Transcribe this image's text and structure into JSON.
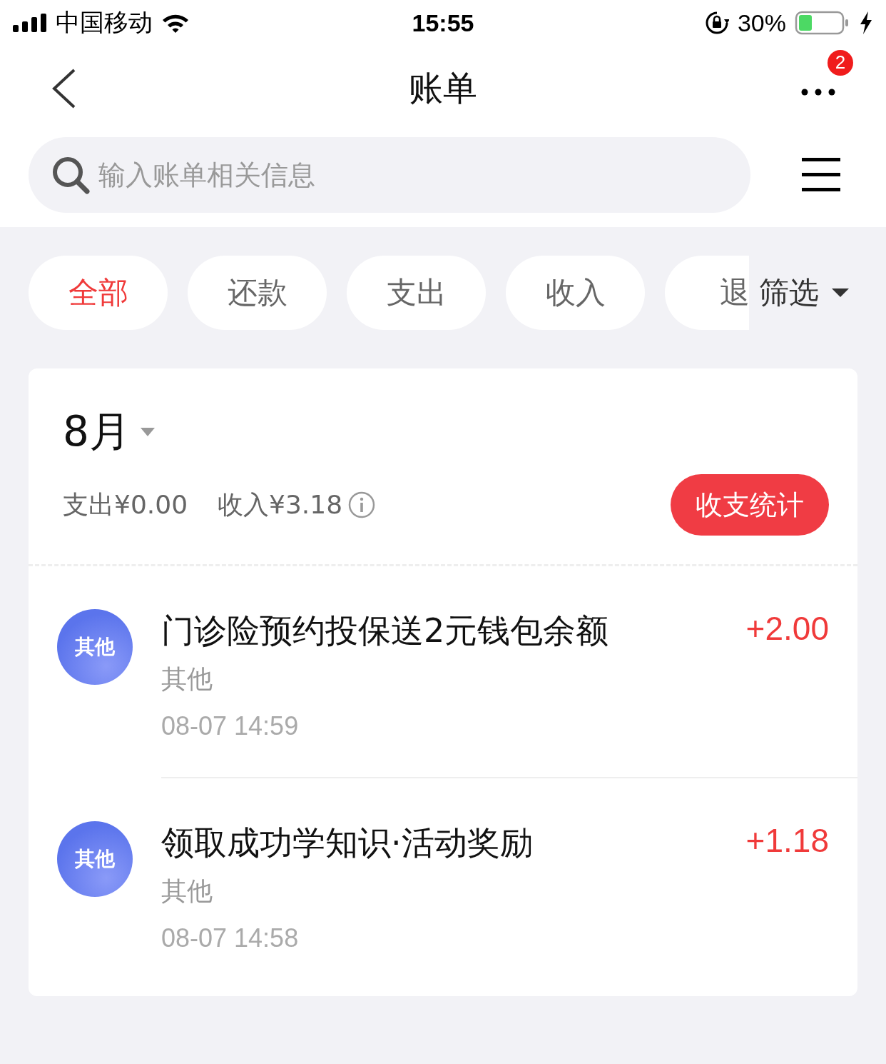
{
  "status_bar": {
    "carrier": "中国移动",
    "time": "15:55",
    "battery": "30%"
  },
  "nav": {
    "title": "账单",
    "badge": "2"
  },
  "search": {
    "placeholder": "输入账单相关信息"
  },
  "tabs": [
    {
      "label": "全部",
      "selected": true
    },
    {
      "label": "还款",
      "selected": false
    },
    {
      "label": "支出",
      "selected": false
    },
    {
      "label": "收入",
      "selected": false
    },
    {
      "label": "退",
      "selected": false
    }
  ],
  "filter": {
    "label": "筛选"
  },
  "month": {
    "label": "8月",
    "expense": "支出¥0.00",
    "income": "收入¥3.18",
    "stats_button": "收支统计"
  },
  "transactions": [
    {
      "avatar": "其他",
      "title": "门诊险预约投保送2元钱包余额",
      "category": "其他",
      "time": "08-07 14:59",
      "amount": "+2.00"
    },
    {
      "avatar": "其他",
      "title": "领取成功学知识·活动奖励",
      "category": "其他",
      "time": "08-07 14:58",
      "amount": "+1.18"
    }
  ]
}
